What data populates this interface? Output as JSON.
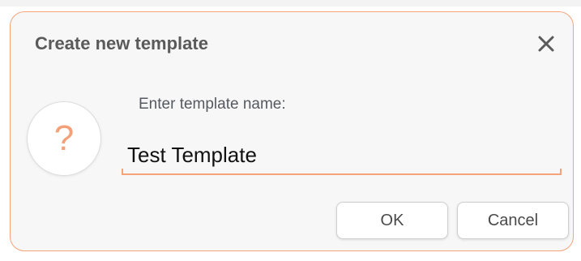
{
  "dialog": {
    "title": "Create new template",
    "close_icon": "close-icon",
    "question_icon": "question-mark-icon",
    "prompt_label": "Enter template name:",
    "name_value": "Test Template",
    "ok_label": "OK",
    "cancel_label": "Cancel"
  },
  "colors": {
    "accent": "#f6a37a",
    "question_mark": "#f4a078",
    "title_text": "#5a5a5a",
    "dialog_background": "#f7f7f7"
  }
}
